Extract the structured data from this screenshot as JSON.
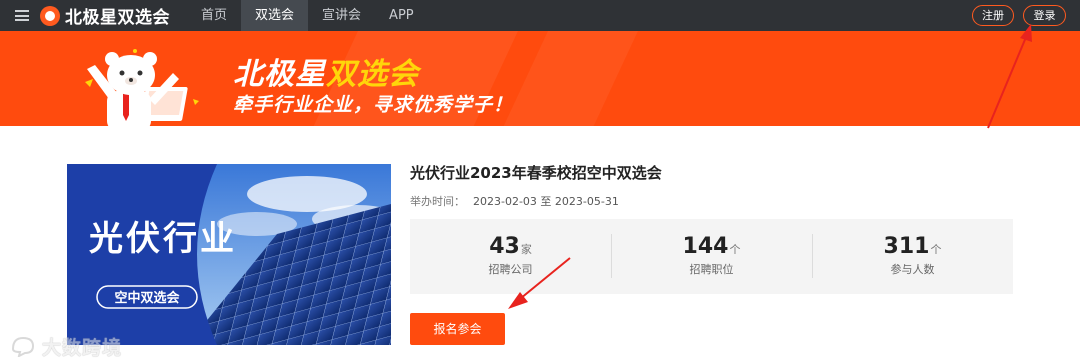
{
  "nav": {
    "brand": "北极星双选会",
    "links": [
      "首页",
      "双选会",
      "宣讲会",
      "APP"
    ],
    "active_index": 1,
    "register_label": "注册",
    "login_label": "登录"
  },
  "banner": {
    "title_main": "北极星",
    "title_accent": "双选会",
    "slogan": "牵手行业企业，寻求优秀学子！"
  },
  "event": {
    "image_title": "光伏行业",
    "image_subtitle": "空中双选会",
    "title": "光伏行业2023年春季校招空中双选会",
    "time_label": "举办时间：",
    "time_value": "2023-02-03 至 2023-05-31",
    "stats": [
      {
        "value": "43",
        "unit": "家",
        "label": "招聘公司"
      },
      {
        "value": "144",
        "unit": "个",
        "label": "招聘职位"
      },
      {
        "value": "311",
        "unit": "个",
        "label": "参与人数"
      }
    ],
    "signup_label": "报名参会"
  },
  "watermark": "大数跨境",
  "colors": {
    "nav_bg": "#2f3236",
    "brand_orange": "#ff4b0e",
    "accent_yellow": "#ffd60a",
    "arrow_red": "#e8231e"
  }
}
